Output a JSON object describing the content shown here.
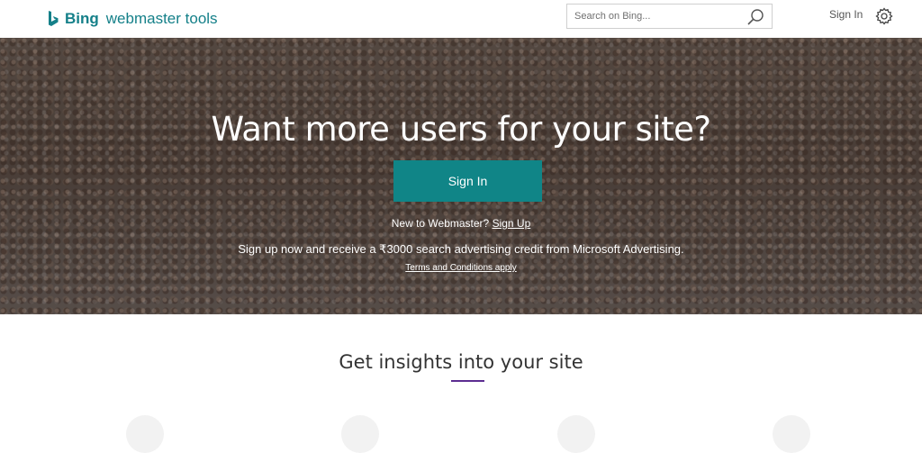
{
  "header": {
    "brand_bing": "Bing",
    "brand_product": "webmaster tools",
    "search_placeholder": "Search on Bing...",
    "signin_label": "Sign In"
  },
  "hero": {
    "title": "Want more users for your site?",
    "signin_button": "Sign In",
    "new_prefix": "New to Webmaster? ",
    "signup_link": "Sign Up",
    "promo": "Sign up now and receive a ₹3000 search advertising credit from Microsoft Advertising.",
    "terms": "Terms and Conditions apply"
  },
  "insights": {
    "title": "Get insights into your site"
  },
  "colors": {
    "brand_teal": "#158089",
    "button_teal": "#108587",
    "accent_purple": "#5c2d91"
  },
  "icons": [
    "bing-logo-icon",
    "search-icon",
    "gear-icon"
  ]
}
